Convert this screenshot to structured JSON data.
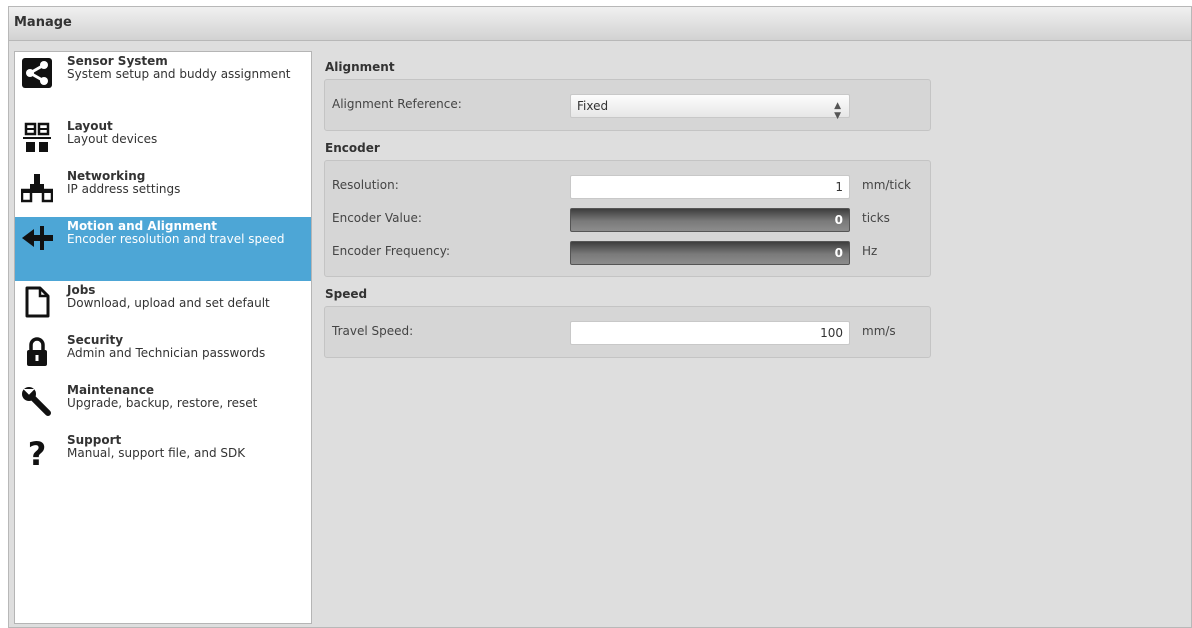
{
  "header": {
    "title": "Manage"
  },
  "sidebar": {
    "items": [
      {
        "title": "Sensor System",
        "desc": "System setup and buddy assignment",
        "icon": "share-icon",
        "selected": false
      },
      {
        "title": "Layout",
        "desc": "Layout devices",
        "icon": "layout-icon",
        "selected": false
      },
      {
        "title": "Networking",
        "desc": "IP address settings",
        "icon": "network-icon",
        "selected": false
      },
      {
        "title": "Motion and Alignment",
        "desc": "Encoder resolution and travel speed",
        "icon": "motion-arrow-icon",
        "selected": true
      },
      {
        "title": "Jobs",
        "desc": "Download, upload and set default",
        "icon": "document-icon",
        "selected": false
      },
      {
        "title": "Security",
        "desc": "Admin and Technician passwords",
        "icon": "lock-icon",
        "selected": false
      },
      {
        "title": "Maintenance",
        "desc": "Upgrade, backup, restore, reset",
        "icon": "wrench-icon",
        "selected": false
      },
      {
        "title": "Support",
        "desc": "Manual, support file, and SDK",
        "icon": "question-icon",
        "selected": false
      }
    ]
  },
  "alignment": {
    "title": "Alignment",
    "reference_label": "Alignment Reference:",
    "reference_value": "Fixed"
  },
  "encoder": {
    "title": "Encoder",
    "resolution_label": "Resolution:",
    "resolution_value": "1",
    "resolution_unit": "mm/tick",
    "value_label": "Encoder Value:",
    "value": "0",
    "value_unit": "ticks",
    "frequency_label": "Encoder Frequency:",
    "frequency": "0",
    "frequency_unit": "Hz"
  },
  "speed": {
    "title": "Speed",
    "travel_label": "Travel Speed:",
    "travel_value": "100",
    "travel_unit": "mm/s"
  },
  "colors": {
    "selected_bg": "#4da6d6",
    "panel_bg": "#dedede",
    "group_bg": "#d6d6d6"
  }
}
